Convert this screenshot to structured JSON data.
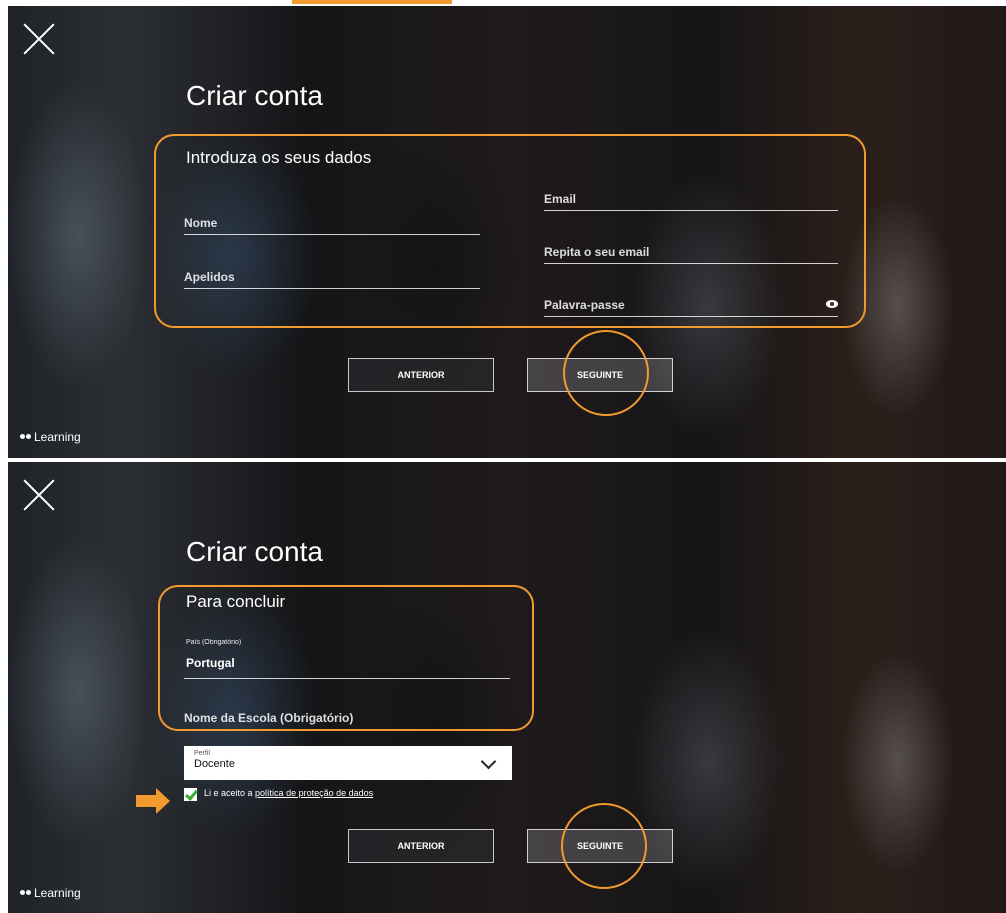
{
  "accent_color": "#f29a2e",
  "brand": {
    "name": "Learning"
  },
  "step1": {
    "title": "Criar conta",
    "section_title": "Introduza os seus dados",
    "fields": {
      "nome": "Nome",
      "apelidos": "Apelidos",
      "email": "Email",
      "repeat_email": "Repita o seu email",
      "password": "Palavra-passe"
    },
    "buttons": {
      "back": "ANTERIOR",
      "next": "SEGUINTE"
    }
  },
  "step2": {
    "title": "Criar conta",
    "section_title": "Para concluir",
    "country": {
      "label": "País (Obrigatório)",
      "value": "Portugal"
    },
    "school": {
      "label": "Nome da Escola (Obrigatório)"
    },
    "profile": {
      "label": "Perfil",
      "value": "Docente"
    },
    "consent": {
      "prefix": "Li e aceito a ",
      "link": "política de proteção de dados",
      "checked": true
    },
    "buttons": {
      "back": "ANTERIOR",
      "next": "SEGUINTE"
    }
  }
}
